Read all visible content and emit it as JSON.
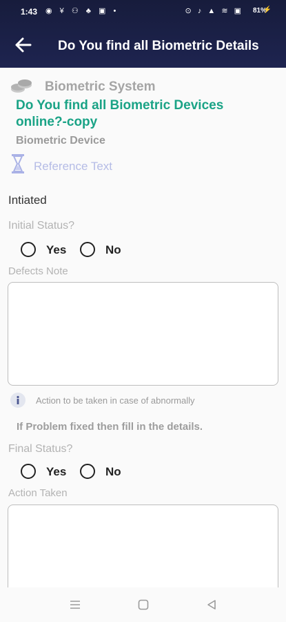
{
  "status_bar": {
    "time": "1:43",
    "left_icons": "◉ ¥ ⚇ ♣ ▣ •",
    "right_icons": "⊙ ♪ ▲ ≋ ▣",
    "network_speed": "5.00",
    "battery": "81%"
  },
  "header": {
    "title": "Do You find all Biometric Details"
  },
  "form": {
    "system_name": "Biometric System",
    "question": "Do You find all Biometric Devices online?-copy",
    "device_label": "Biometric Device",
    "reference_text": "Reference Text",
    "stage": "Intiated",
    "initial_status_label": "Initial Status?",
    "initial_options": [
      "Yes",
      "No"
    ],
    "defects_note_label": "Defects Note",
    "defects_note_value": "",
    "info_note": "Action to be taken in case of abnormally",
    "hint": "If Problem fixed then fill in the details.",
    "final_status_label": "Final Status?",
    "final_options": [
      "Yes",
      "No"
    ],
    "action_taken_label": "Action Taken",
    "action_taken_value": ""
  },
  "colors": {
    "appbar": "#1e2450",
    "accent_teal": "#1aa386",
    "reference_blue": "#b5bce6",
    "muted_gray": "#b3b3b3"
  },
  "nav": {
    "icons": [
      "menu-icon",
      "home-square-icon",
      "back-triangle-icon"
    ]
  }
}
